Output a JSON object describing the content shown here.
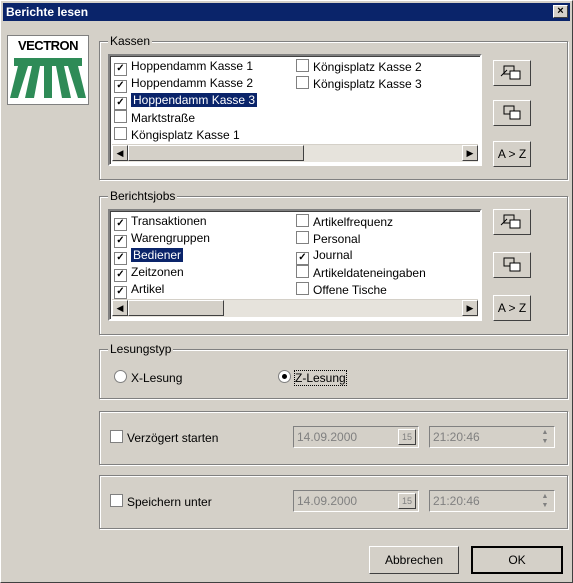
{
  "window": {
    "title": "Berichte lesen",
    "close_glyph": "×"
  },
  "logo": {
    "text": "VECTRON"
  },
  "kassen": {
    "label": "Kassen",
    "items": [
      {
        "label": "Hoppendamm Kasse 1",
        "checked": true,
        "selected": false
      },
      {
        "label": "Hoppendamm Kasse 2",
        "checked": true,
        "selected": false
      },
      {
        "label": "Hoppendamm Kasse 3",
        "checked": true,
        "selected": true
      },
      {
        "label": "Marktstraße",
        "checked": false,
        "selected": false
      },
      {
        "label": "Köngisplatz Kasse 1",
        "checked": false,
        "selected": false
      },
      {
        "label": "Köngisplatz Kasse 2",
        "checked": false,
        "selected": false
      },
      {
        "label": "Köngisplatz Kasse 3",
        "checked": false,
        "selected": false
      }
    ],
    "sort_label": "A > Z"
  },
  "berichtsjobs": {
    "label": "Berichtsjobs",
    "items": [
      {
        "label": "Transaktionen",
        "checked": true,
        "selected": false
      },
      {
        "label": "Warengruppen",
        "checked": true,
        "selected": false
      },
      {
        "label": "Bediener",
        "checked": true,
        "selected": true
      },
      {
        "label": "Zeitzonen",
        "checked": true,
        "selected": false
      },
      {
        "label": "Artikel",
        "checked": true,
        "selected": false
      },
      {
        "label": "Artikelfrequenz",
        "checked": false,
        "selected": false
      },
      {
        "label": "Personal",
        "checked": false,
        "selected": false
      },
      {
        "label": "Journal",
        "checked": true,
        "selected": false
      },
      {
        "label": "Artikeldateneingaben",
        "checked": false,
        "selected": false
      },
      {
        "label": "Offene Tische",
        "checked": false,
        "selected": false
      }
    ],
    "sort_label": "A > Z"
  },
  "lesungstyp": {
    "label": "Lesungstyp",
    "options": [
      {
        "label": "X-Lesung",
        "selected": false
      },
      {
        "label": "Z-Lesung",
        "selected": true
      }
    ]
  },
  "verzoegert": {
    "label": "Verzögert starten",
    "checked": false,
    "date": "14.09.2000",
    "time": "21:20:46",
    "cal": "15"
  },
  "speichern": {
    "label": "Speichern unter",
    "checked": false,
    "date": "14.09.2000",
    "time": "21:20:46",
    "cal": "15"
  },
  "buttons": {
    "cancel": "Abbrechen",
    "ok": "OK"
  }
}
